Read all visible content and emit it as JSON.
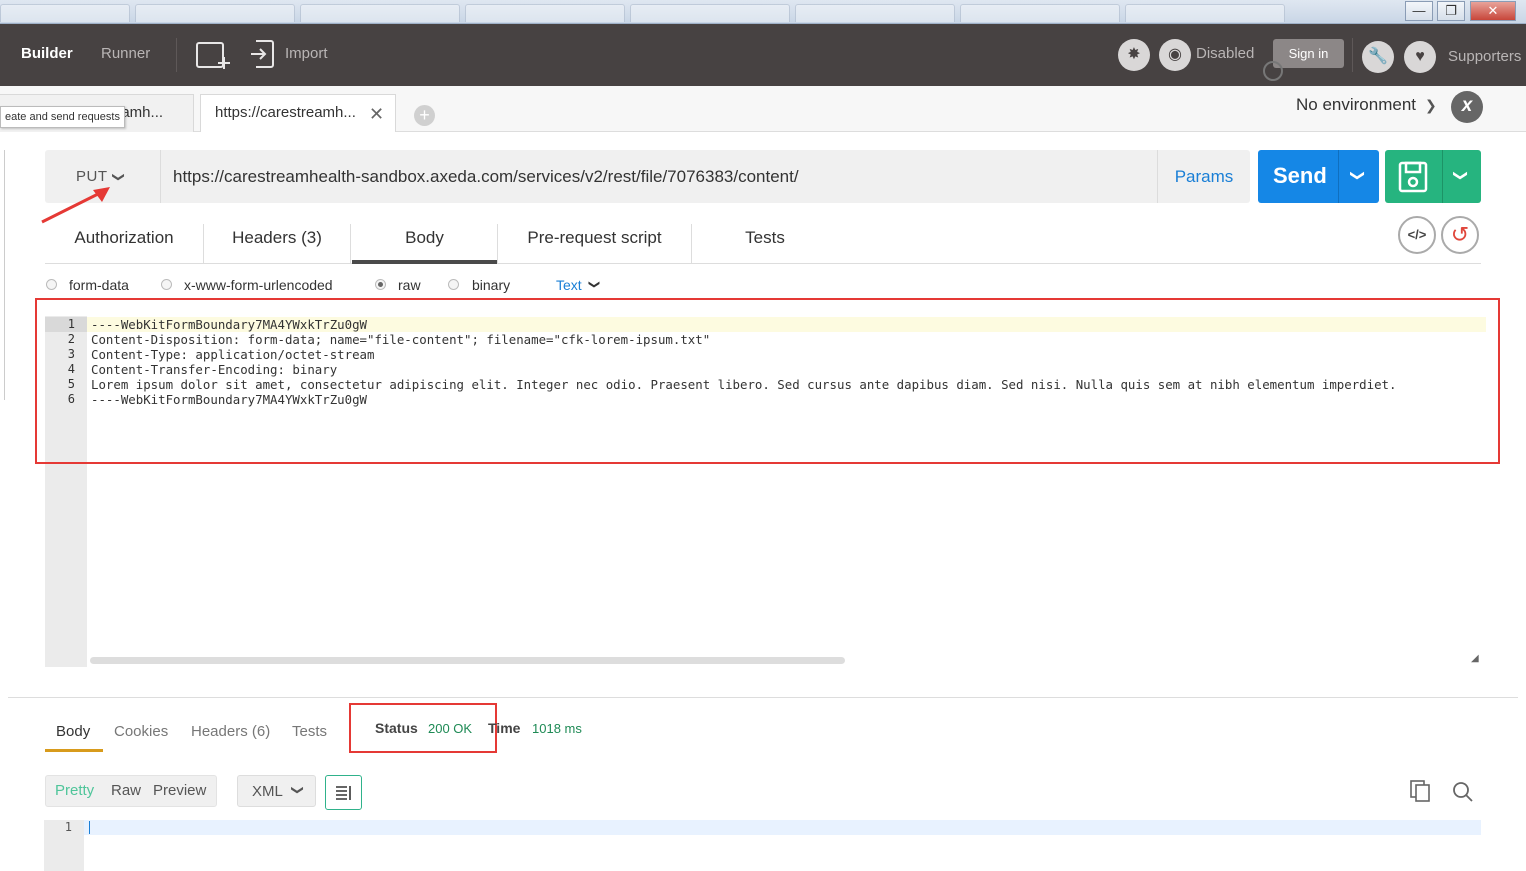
{
  "toolbar": {
    "builder": "Builder",
    "runner": "Runner",
    "import": "Import",
    "sync_status": "Disabled",
    "signin": "Sign in",
    "supporters": "Supporters"
  },
  "tabs": {
    "tooltip": "eate and send requests",
    "first_tab_label": "eamh...",
    "active_tab_label": "https://carestreamh...",
    "environment": "No environment"
  },
  "request": {
    "method": "PUT",
    "url": "https://carestreamhealth-sandbox.axeda.com/services/v2/rest/file/7076383/content/",
    "params": "Params",
    "send": "Send"
  },
  "subtabs": {
    "authorization": "Authorization",
    "headers": "Headers (3)",
    "body": "Body",
    "prerequest": "Pre-request script",
    "tests": "Tests"
  },
  "body_options": {
    "form_data": "form-data",
    "urlencoded": "x-www-form-urlencoded",
    "raw": "raw",
    "binary": "binary",
    "content_type": "Text"
  },
  "editor": {
    "line_numbers": [
      "1",
      "2",
      "3",
      "4",
      "5",
      "6"
    ],
    "lines": [
      "----WebKitFormBoundary7MA4YWxkTrZu0gW",
      "Content-Disposition: form-data; name=\"file-content\"; filename=\"cfk-lorem-ipsum.txt\"",
      "Content-Type: application/octet-stream",
      "Content-Transfer-Encoding: binary",
      "Lorem ipsum dolor sit amet, consectetur adipiscing elit. Integer nec odio. Praesent libero. Sed cursus ante dapibus diam. Sed nisi. Nulla quis sem at nibh elementum imperdiet.",
      "----WebKitFormBoundary7MA4YWxkTrZu0gW"
    ]
  },
  "response": {
    "tabs": {
      "body": "Body",
      "cookies": "Cookies",
      "headers": "Headers (6)",
      "tests": "Tests"
    },
    "status_label": "Status",
    "status_value": "200 OK",
    "time_label": "Time",
    "time_value": "1018 ms",
    "formats": {
      "pretty": "Pretty",
      "raw": "Raw",
      "preview": "Preview"
    },
    "language": "XML",
    "line_number": "1"
  },
  "colors": {
    "toolbar_bg": "#474242",
    "send_blue": "#1587e6",
    "save_green": "#26b47f",
    "status_green": "#1e8a55",
    "annotation_red": "#e53935"
  }
}
